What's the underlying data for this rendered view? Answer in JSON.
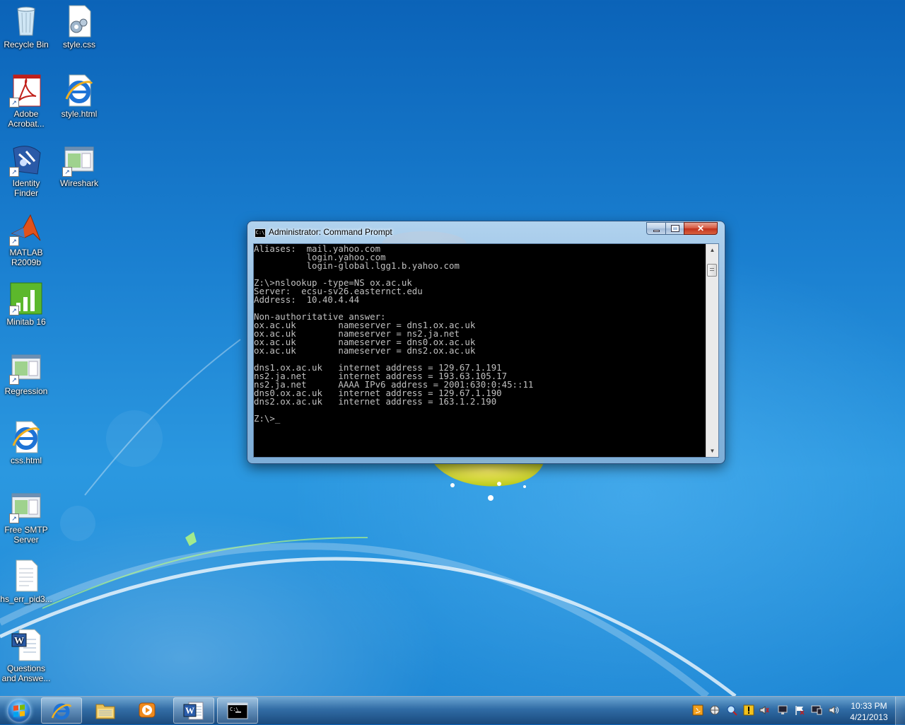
{
  "desktop": {
    "icons": [
      {
        "label": "Recycle Bin",
        "icon": "recycle-bin-icon"
      },
      {
        "label": "style.css",
        "icon": "css-file-icon"
      },
      {
        "label": "Adobe Acrobat...",
        "icon": "adobe-acrobat-icon"
      },
      {
        "label": "style.html",
        "icon": "ie-file-icon"
      },
      {
        "label": "Identity Finder",
        "icon": "identity-finder-icon"
      },
      {
        "label": "Wireshark",
        "icon": "wireshark-icon"
      },
      {
        "label": "MATLAB R2009b",
        "icon": "matlab-icon"
      },
      {
        "label": "Minitab 16",
        "icon": "minitab-icon"
      },
      {
        "label": "Regression",
        "icon": "regression-icon"
      },
      {
        "label": "css.html",
        "icon": "ie-file-icon"
      },
      {
        "label": "Free SMTP Server",
        "icon": "smtp-server-icon"
      },
      {
        "label": "hs_err_pid3...",
        "icon": "text-file-icon"
      },
      {
        "label": "Questions and Answe...",
        "icon": "word-doc-icon"
      }
    ]
  },
  "cmd_window": {
    "title": "Administrator: Command Prompt",
    "app_icon_text": "C:\\",
    "output": "Aliases:  mail.yahoo.com\n          login.yahoo.com\n          login-global.lgg1.b.yahoo.com\n\nZ:\\>nslookup -type=NS ox.ac.uk\nServer:  ecsu-sv26.easternct.edu\nAddress:  10.40.4.44\n\nNon-authoritative answer:\nox.ac.uk        nameserver = dns1.ox.ac.uk\nox.ac.uk        nameserver = ns2.ja.net\nox.ac.uk        nameserver = dns0.ox.ac.uk\nox.ac.uk        nameserver = dns2.ox.ac.uk\n\ndns1.ox.ac.uk   internet address = 129.67.1.191\nns2.ja.net      internet address = 193.63.105.17\nns2.ja.net      AAAA IPv6 address = 2001:630:0:45::11\ndns0.ox.ac.uk   internet address = 129.67.1.190\ndns2.ox.ac.uk   internet address = 163.1.2.190\n\nZ:\\>_",
    "scroll_up_arrow": "▲",
    "scroll_down_arrow": "▼",
    "close_glyph": "✕"
  },
  "taskbar": {
    "pinned": [
      {
        "name": "internet-explorer-icon",
        "active": true
      },
      {
        "name": "windows-explorer-icon",
        "active": false
      },
      {
        "name": "media-player-icon",
        "active": false
      },
      {
        "name": "microsoft-word-icon",
        "active": true
      },
      {
        "name": "command-prompt-icon",
        "active": true
      }
    ],
    "cmd_icon_text": "C:\\",
    "word_icon_text": "W",
    "tray_icons": [
      "java-icon",
      "network-globe-icon",
      "security-scan-icon",
      "warning-icon",
      "speaker-icon",
      "network-icon",
      "action-center-flag-icon",
      "display-icon",
      "volume-icon"
    ],
    "clock": {
      "time": "10:33 PM",
      "date": "4/21/2013"
    }
  },
  "colors": {
    "console_bg": "#000000",
    "console_fg": "#c0c0c0",
    "desktop_blue": "#1a7fd0",
    "close_red": "#c0311c"
  }
}
